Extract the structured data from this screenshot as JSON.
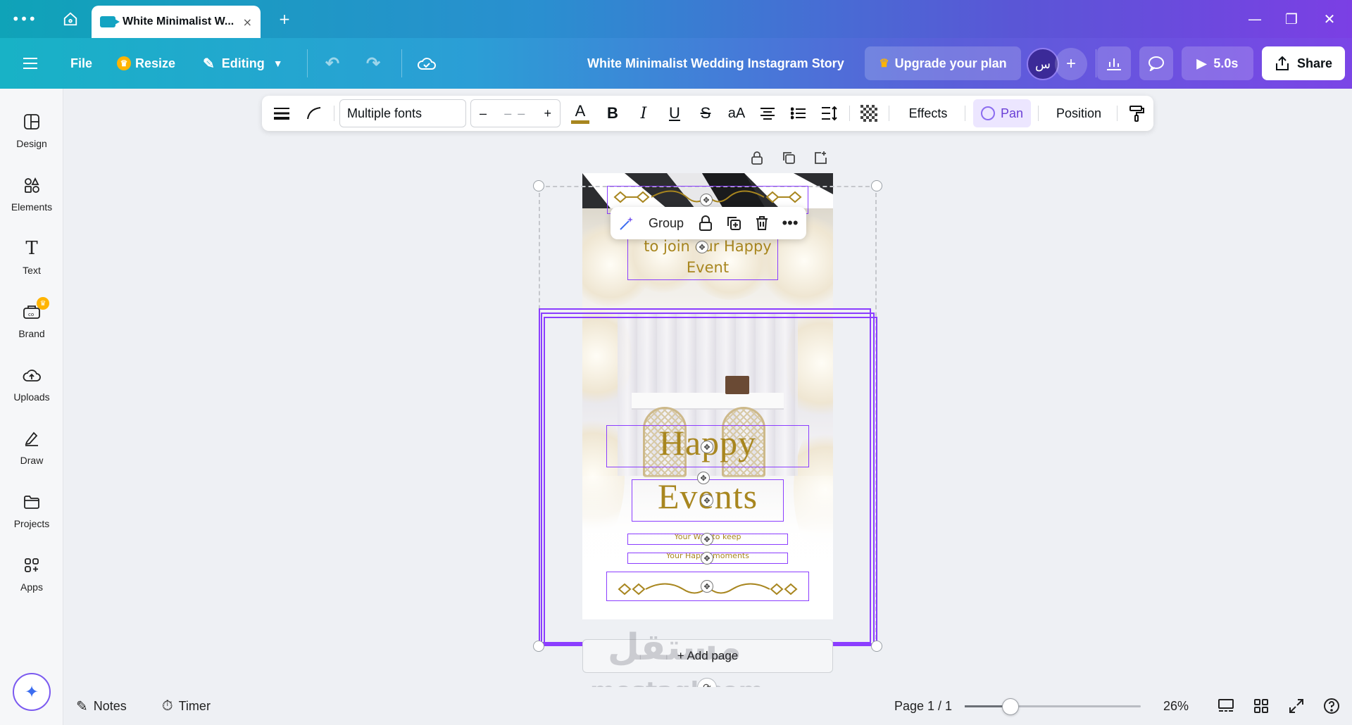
{
  "browser": {
    "tab_title": "White Minimalist W...",
    "tab_close": "×",
    "new_tab": "+",
    "menu_icon": "more-horizontal-icon",
    "home_icon": "home-icon",
    "window": {
      "minimize": "—",
      "restore": "❐",
      "close": "✕"
    }
  },
  "header": {
    "menu_icon": "menu-icon",
    "file": "File",
    "resize": "Resize",
    "editing": "Editing",
    "doc_title": "White Minimalist Wedding Instagram Story",
    "upgrade": "Upgrade your plan",
    "avatar_text": "س",
    "play_duration": "5.0s",
    "share": "Share",
    "accent": "#7b45e6"
  },
  "sidebar": {
    "items": [
      {
        "label": "Design",
        "icon": "layout-icon"
      },
      {
        "label": "Elements",
        "icon": "shapes-icon"
      },
      {
        "label": "Text",
        "icon": "text-icon"
      },
      {
        "label": "Brand",
        "icon": "brand-icon"
      },
      {
        "label": "Uploads",
        "icon": "cloud-upload-icon"
      },
      {
        "label": "Draw",
        "icon": "pen-icon"
      },
      {
        "label": "Projects",
        "icon": "folder-icon"
      },
      {
        "label": "Apps",
        "icon": "apps-grid-icon"
      }
    ]
  },
  "toolbar": {
    "font": "Multiple fonts",
    "size_minus": "–",
    "size_value": "– –",
    "size_plus": "+",
    "text_color_glyph": "A",
    "bold": "B",
    "italic": "I",
    "underline": "U",
    "strike": "S",
    "case": "aA",
    "effects": "Effects",
    "pan": "Pan",
    "position": "Position",
    "text_color": "#a8861f"
  },
  "context_menu": {
    "group": "Group"
  },
  "design": {
    "line1": "to join our Happy",
    "line2": "Event",
    "title1": "Happy",
    "title2": "Events",
    "small1": "Your Way to keep",
    "small2": "Your Happy moments",
    "gold": "#a8861f"
  },
  "canvas": {
    "add_page": "+ Add page",
    "watermark_ar": "مستقل",
    "watermark_en": "mostaql.com"
  },
  "footer": {
    "notes": "Notes",
    "timer": "Timer",
    "page": "Page 1 / 1",
    "zoom": "26%",
    "zoom_fraction": 0.26
  }
}
